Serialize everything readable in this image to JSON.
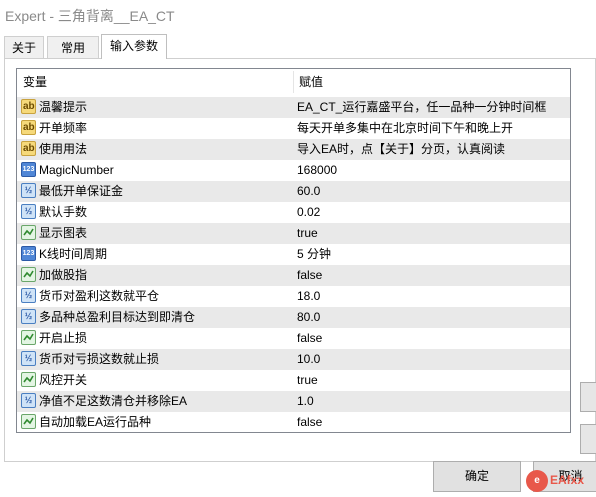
{
  "window": {
    "title": "Expert - 三角背离__EA_CT"
  },
  "tabs": [
    {
      "label": "关于",
      "active": false
    },
    {
      "label": "常用",
      "active": false
    },
    {
      "label": "输入参数",
      "active": true
    }
  ],
  "table": {
    "columns": [
      "变量",
      "赋值"
    ],
    "rows": [
      {
        "icon": "text-icon",
        "name": "温馨提示",
        "value": "EA_CT_运行嘉盛平台，任一品种一分钟时间框"
      },
      {
        "icon": "text-icon",
        "name": "开单频率",
        "value": "每天开单多集中在北京时间下午和晚上开"
      },
      {
        "icon": "text-icon",
        "name": "使用用法",
        "value": "导入EA时，点【关于】分页，认真阅读"
      },
      {
        "icon": "integer-icon",
        "name": "MagicNumber",
        "value": "168000"
      },
      {
        "icon": "double-icon",
        "name": "最低开单保证金",
        "value": "60.0"
      },
      {
        "icon": "double-icon",
        "name": "默认手数",
        "value": "0.02"
      },
      {
        "icon": "bool-icon",
        "name": "显示图表",
        "value": "true"
      },
      {
        "icon": "integer-icon",
        "name": "K线时间周期",
        "value": " 5 分钟"
      },
      {
        "icon": "bool-icon",
        "name": "加做股指",
        "value": "false"
      },
      {
        "icon": "double-icon",
        "name": "货币对盈利这数就平仓",
        "value": "18.0"
      },
      {
        "icon": "double-icon",
        "name": "多品种总盈利目标达到即清仓",
        "value": "80.0"
      },
      {
        "icon": "bool-icon",
        "name": "开启止损",
        "value": "false"
      },
      {
        "icon": "double-icon",
        "name": "货币对亏损这数就止损",
        "value": "10.0"
      },
      {
        "icon": "bool-icon",
        "name": "风控开关",
        "value": "true"
      },
      {
        "icon": "double-icon",
        "name": "净值不足这数清仓并移除EA",
        "value": "1.0"
      },
      {
        "icon": "bool-icon",
        "name": "自动加载EA运行品种",
        "value": "false"
      }
    ]
  },
  "buttons": {
    "ok": "确定",
    "cancel": "取消"
  },
  "watermark": {
    "text": "EAfxx"
  }
}
